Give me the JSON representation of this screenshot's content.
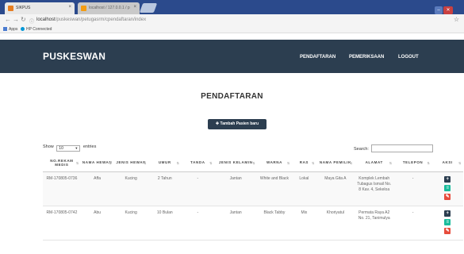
{
  "browser": {
    "tabs": [
      {
        "title": "SIKPUS",
        "close": "×"
      },
      {
        "title": "localhost / 127.0.0.1 / p",
        "close": "×"
      }
    ],
    "url_host": "localhost",
    "url_path": "/puskeswan/petugasrm/cpendaftaran/index",
    "bookmarks": [
      "Apps",
      "HP Connected"
    ],
    "colors": {
      "tabbar": "#2b4a8c",
      "favicon1": "#e67e22",
      "favicon2": "#f39c12"
    }
  },
  "app": {
    "brand": "PUSKESWAN",
    "nav": [
      "PENDAFTARAN",
      "PEMERIKSAAN",
      "LOGOUT"
    ],
    "colors": {
      "header": "#2c3e50",
      "add": "#1abc9c",
      "edit": "#e74c3c"
    }
  },
  "page": {
    "title": "PENDAFTARAN",
    "add_button": "Tambah Pasien baru",
    "length": {
      "show": "Show",
      "value": "10",
      "entries": "entries"
    },
    "search_label": "Search:"
  },
  "table": {
    "columns": [
      "NO.REKAM MEDIS",
      "NAMA HEWAN",
      "JENIS HEWAN",
      "UMUR",
      "TANDA",
      "JENIS KELAMIN",
      "WARNA",
      "RAS",
      "NAMA PEMILIK",
      "ALAMAT",
      "TELEPON",
      "AKSI"
    ],
    "rows": [
      {
        "no": "RM-170805-0736",
        "nama": "Affa",
        "jenis": "Kucing",
        "umur": "2 Tahun",
        "tanda": "-",
        "kelamin": "Jantan",
        "warna": "White and Black",
        "ras": "Lokal",
        "pemilik": "Maya Gita A",
        "alamat": "Komplek Lembah Tubagus Ismail No. 8 Kav. 4, Sekeloa",
        "telepon": "-"
      },
      {
        "no": "RM-170805-0742",
        "nama": "Abu",
        "jenis": "Kucing",
        "umur": "10 Bulan",
        "tanda": "-",
        "kelamin": "Jantan",
        "warna": "Black Tabby",
        "ras": "Mix",
        "pemilik": "Khoriyatul",
        "alamat": "Permata Raya A2 No. 21, Tanimulya",
        "telepon": "-"
      }
    ]
  }
}
